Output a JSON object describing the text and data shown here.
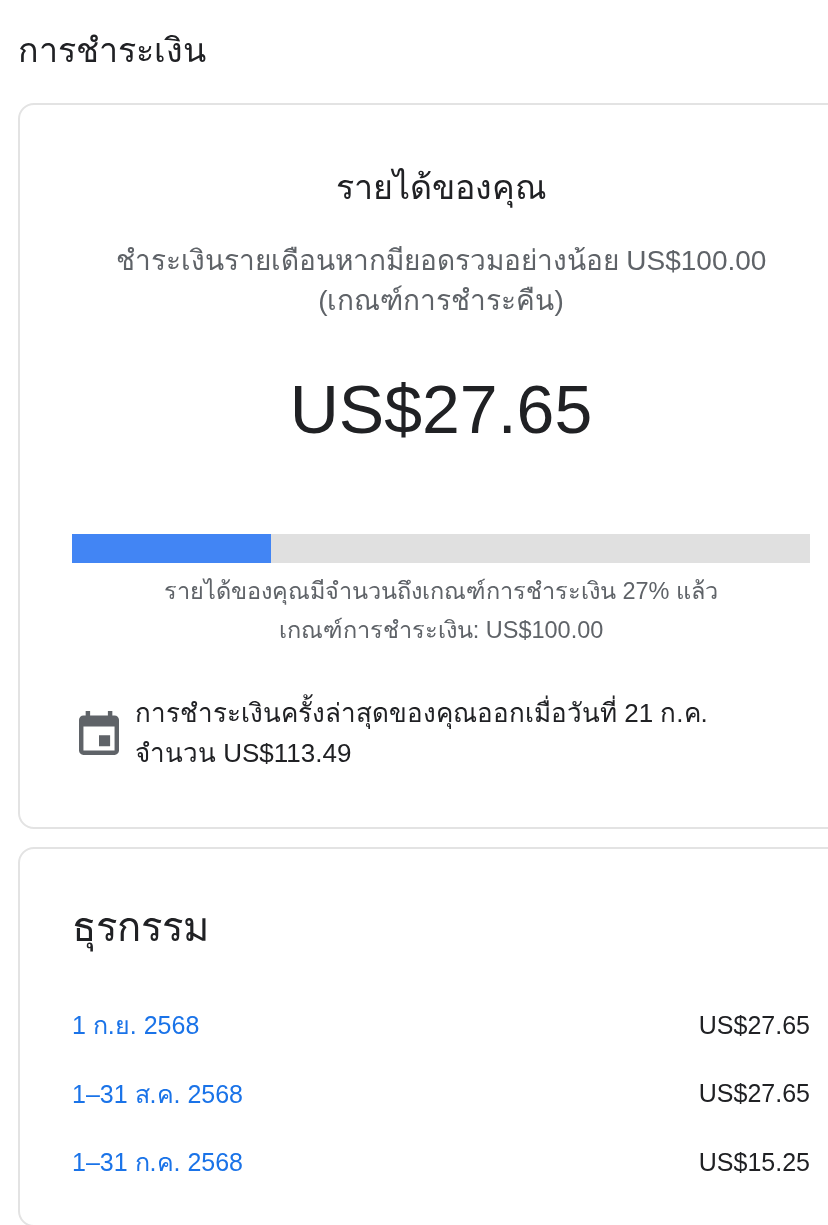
{
  "page_title": "การชำระเงิน",
  "earnings_card": {
    "title": "รายได้ของคุณ",
    "description": "ชำระเงินรายเดือนหากมียอดรวมอย่างน้อย US$100.00 (เกณฑ์การชำระคืน)",
    "balance": "US$27.65",
    "progress": {
      "level": 0.27
    },
    "progress_caption": "รายได้ของคุณมีจำนวนถึงเกณฑ์การชำระเงิน 27% แล้ว",
    "threshold": "เกณฑ์การชำระเงิน: US$100.00",
    "last_payment": "การชำระเงินครั้งล่าสุดของคุณออกเมื่อวันที่ 21 ก.ค. จำนวน US$113.49"
  },
  "transactions": {
    "title": "ธุรกรรม",
    "rows": [
      {
        "period": "1 ก.ย. 2568",
        "amount": "US$27.65"
      },
      {
        "period": "1–31 ส.ค. 2568",
        "amount": "US$27.65"
      },
      {
        "period": "1–31 ก.ค. 2568",
        "amount": "US$15.25"
      }
    ]
  }
}
